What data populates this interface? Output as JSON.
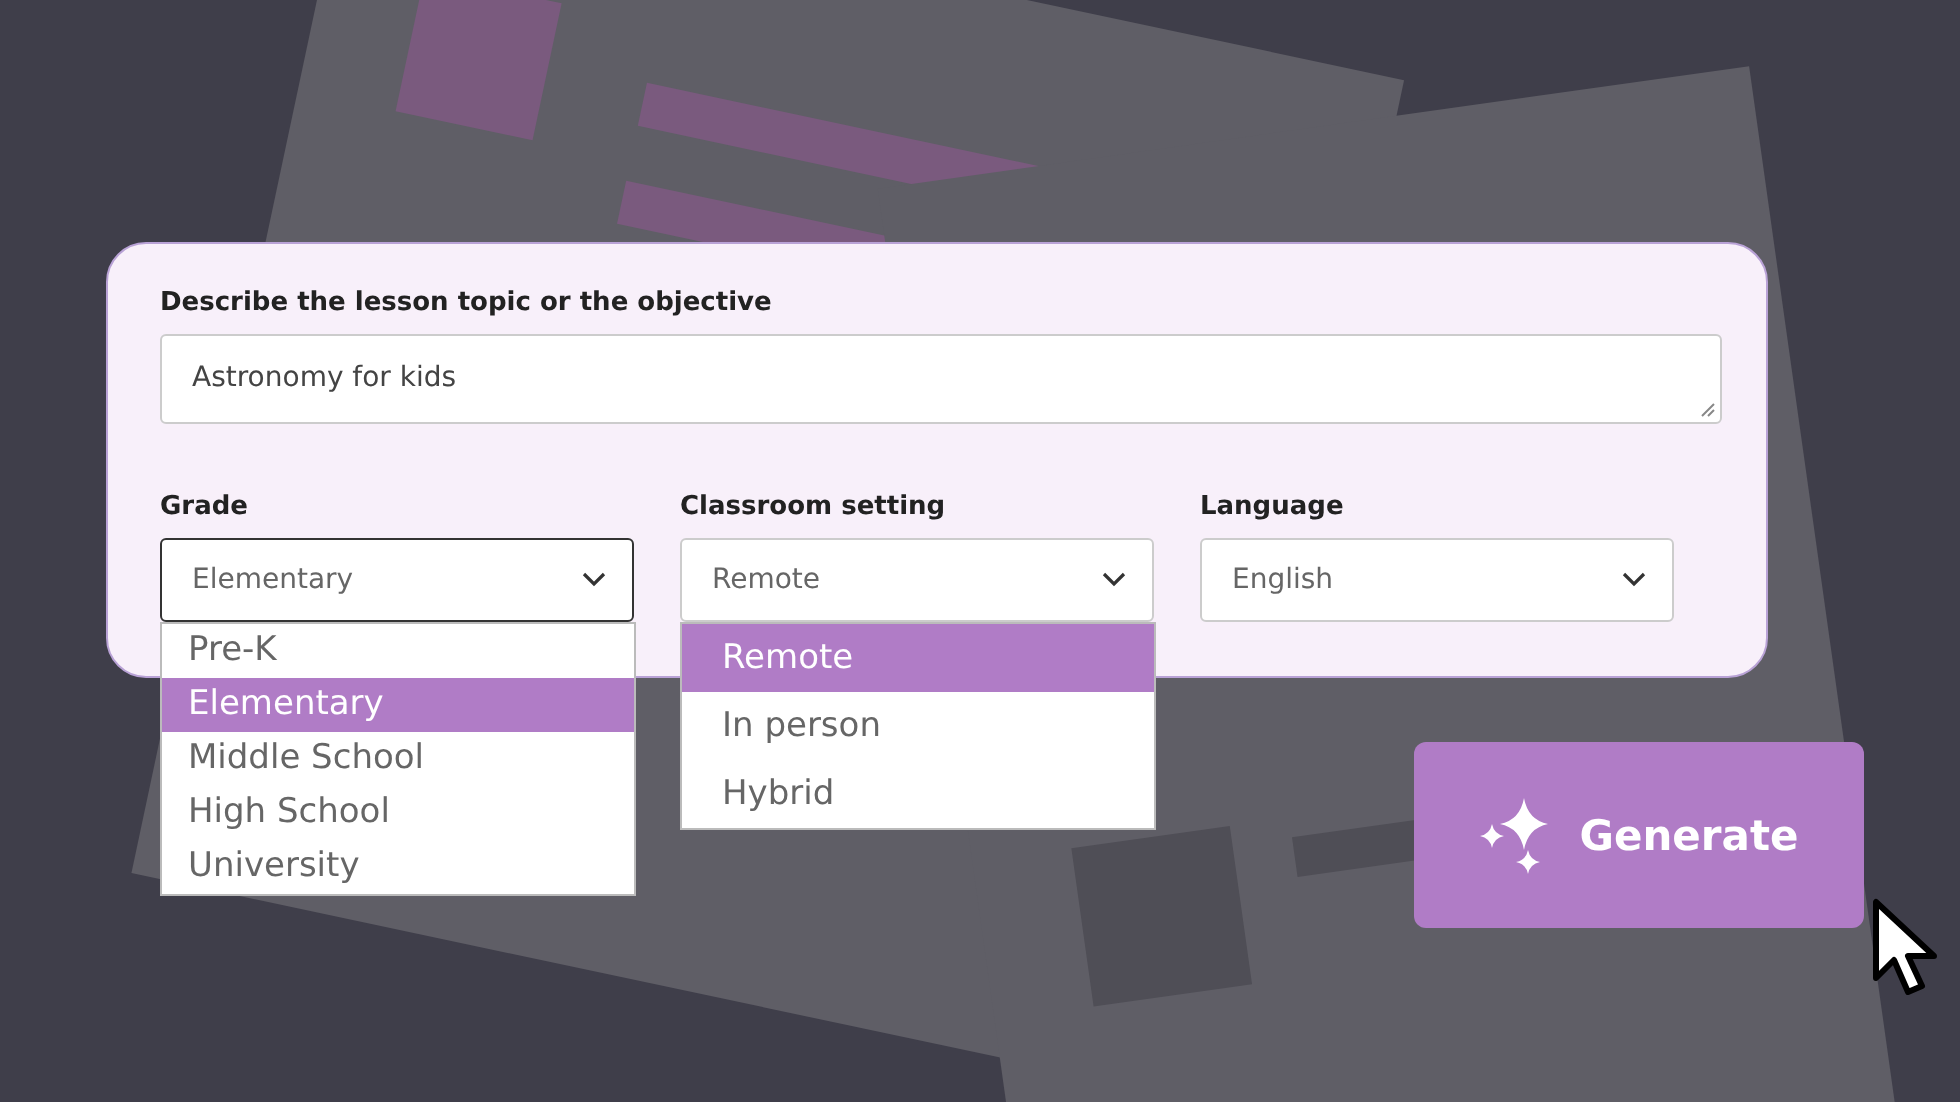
{
  "topic": {
    "label": "Describe the lesson topic or the objective",
    "value": "Astronomy for kids"
  },
  "selects": [
    {
      "label": "Grade",
      "value": "Elementary",
      "focused": true,
      "options": [
        {
          "label": "Pre-K",
          "selected": false
        },
        {
          "label": "Elementary",
          "selected": true
        },
        {
          "label": "Middle School",
          "selected": false
        },
        {
          "label": "High School",
          "selected": false
        },
        {
          "label": "University",
          "selected": false
        }
      ]
    },
    {
      "label": "Classroom setting",
      "value": "Remote",
      "focused": false,
      "options": [
        {
          "label": "Remote",
          "selected": true
        },
        {
          "label": "In person",
          "selected": false
        },
        {
          "label": "Hybrid",
          "selected": false
        }
      ]
    },
    {
      "label": "Language",
      "value": "English",
      "focused": false
    }
  ],
  "generate": {
    "label": "Generate"
  }
}
